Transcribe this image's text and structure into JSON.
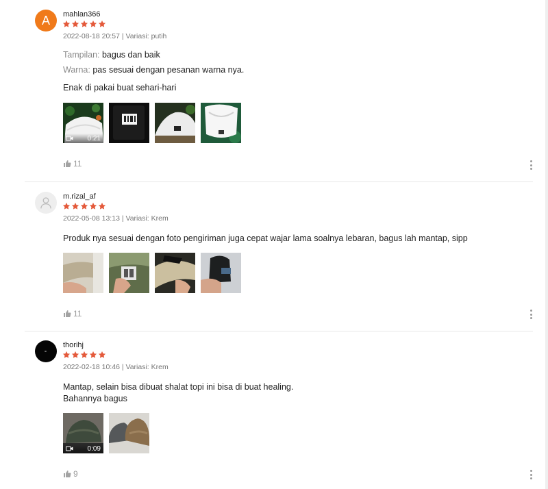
{
  "reviews": [
    {
      "username": "mahlan366",
      "avatar_letter": "A",
      "avatar_color": "#f07a1a",
      "rating": 5,
      "meta": "2022-08-18 20:57 | Variasi: putih",
      "attributes": [
        {
          "label": "Tampilan:",
          "value": "bagus dan baik"
        },
        {
          "label": "Warna:",
          "value": "pas sesuai dengan pesanan warna nya."
        }
      ],
      "text": "Enak di pakai buat sehari-hari",
      "video_duration": "0:21",
      "likes": "11"
    },
    {
      "username": "m.rizal_af",
      "rating": 5,
      "meta": "2022-05-08 13:13 | Variasi: Krem",
      "text": "Produk nya sesuai dengan foto pengiriman juga cepat wajar lama soalnya lebaran, bagus lah mantap, sipp",
      "likes": "11"
    },
    {
      "username": "thorihj",
      "rating": 5,
      "meta": "2022-02-18 10:46 | Variasi: Krem",
      "text_lines": [
        "Mantap, selain bisa dibuat shalat topi ini bisa di buat healing.",
        "Bahannya bagus"
      ],
      "video_duration": "0:09",
      "likes": "9"
    }
  ],
  "colors": {
    "star": "#e45a3b",
    "accent": "#ee4d2d",
    "muted": "#9a9a9a"
  },
  "icons": {
    "like": "thumbs-up-icon",
    "more": "more-vertical-icon",
    "video": "video-camera-icon",
    "user": "user-icon"
  }
}
